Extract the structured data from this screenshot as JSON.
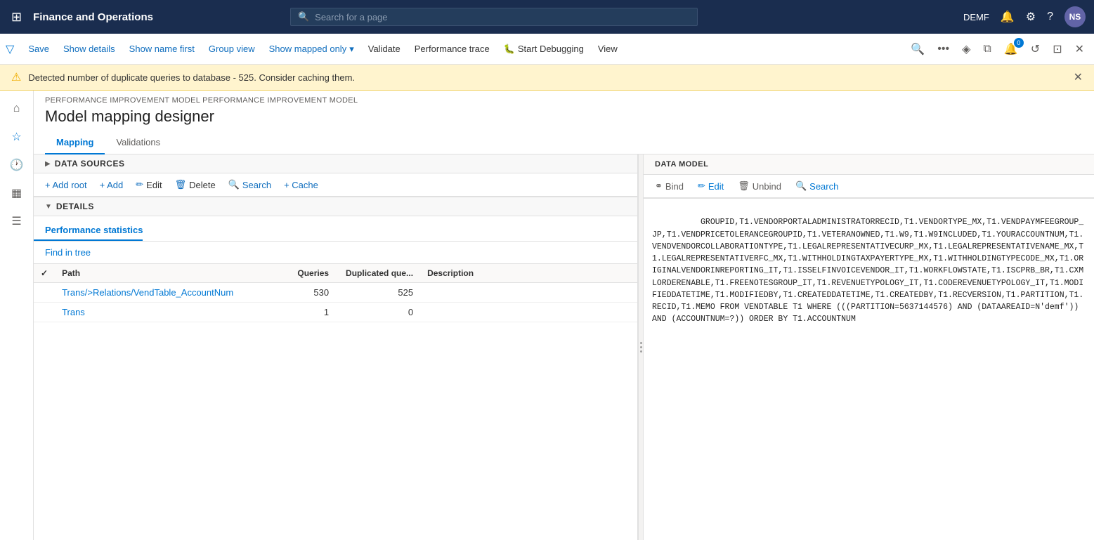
{
  "topnav": {
    "grid_icon": "⊞",
    "title": "Finance and Operations",
    "search_placeholder": "Search for a page",
    "user": "DEMF",
    "avatar": "NS"
  },
  "toolbar": {
    "save_label": "Save",
    "show_details_label": "Show details",
    "show_name_first_label": "Show name first",
    "group_view_label": "Group view",
    "show_mapped_only_label": "Show mapped only",
    "validate_label": "Validate",
    "performance_trace_label": "Performance trace",
    "start_debugging_label": "Start Debugging",
    "view_label": "View"
  },
  "warning": {
    "message": "Detected number of duplicate queries to database - 525. Consider caching them."
  },
  "breadcrumb": "PERFORMANCE IMPROVEMENT MODEL PERFORMANCE IMPROVEMENT MODEL",
  "page_title": "Model mapping designer",
  "tabs": {
    "mapping": "Mapping",
    "validations": "Validations"
  },
  "data_sources": {
    "section_title": "DATA SOURCES",
    "add_root_label": "+ Add root",
    "add_label": "+ Add",
    "edit_label": "Edit",
    "delete_label": "Delete",
    "search_label": "Search",
    "cache_label": "+ Cache"
  },
  "details": {
    "section_title": "DETAILS",
    "perf_statistics_label": "Performance statistics",
    "find_in_tree_label": "Find in tree"
  },
  "table": {
    "headers": {
      "check": "",
      "path": "Path",
      "queries": "Queries",
      "duplicated": "Duplicated que...",
      "description": "Description"
    },
    "rows": [
      {
        "check": "",
        "path": "Trans/>Relations/VendTable_AccountNum",
        "queries": "530",
        "duplicated": "525",
        "description": ""
      },
      {
        "check": "",
        "path": "Trans",
        "queries": "1",
        "duplicated": "0",
        "description": ""
      }
    ]
  },
  "data_model": {
    "section_title": "DATA MODEL",
    "bind_label": "Bind",
    "edit_label": "Edit",
    "unbind_label": "Unbind",
    "search_label": "Search"
  },
  "sql_text": "GROUPID,T1.VENDORPORTALADMINISTRATORRECID,T1.VENDORTYPE_MX,T1.VENDPAYMFEEGROUP_JP,T1.VENDPRICETOLERANCEGROUPID,T1.VETERANOWNED,T1.W9,T1.W9INCLUDED,T1.YOURACCOUNTNUM,T1.VENDVENDORCOLLABORATIONTYPE,T1.LEGALREPRESENTATIVECURP_MX,T1.LEGALREPRESENTATIVENAME_MX,T1.LEGALREPRESENTATIVERFC_MX,T1.WITHHOLDINGTAXPAYERTYPE_MX,T1.WITHHOLDINGTYPECODE_MX,T1.ORIGINALVENDORINREPORTING_IT,T1.ISSELFINVOICEVENDOR_IT,T1.WORKFLOWSTATE,T1.ISCPRB_BR,T1.CXMLORDERENABLE,T1.FREENOTESGROUP_IT,T1.REVENUETYPOLOGY_IT,T1.CODEREVENUETYPOLOGY_IT,T1.MODIFIEDDATETIME,T1.MODIFIEDBY,T1.CREATEDDATETIME,T1.CREATEDBY,T1.RECVERSION,T1.PARTITION,T1.RECID,T1.MEMO FROM VENDTABLE T1 WHERE (((PARTITION=5637144576) AND (DATAAREAID=N'demf')) AND (ACCOUNTNUM=?)) ORDER BY T1.ACCOUNTNUM"
}
